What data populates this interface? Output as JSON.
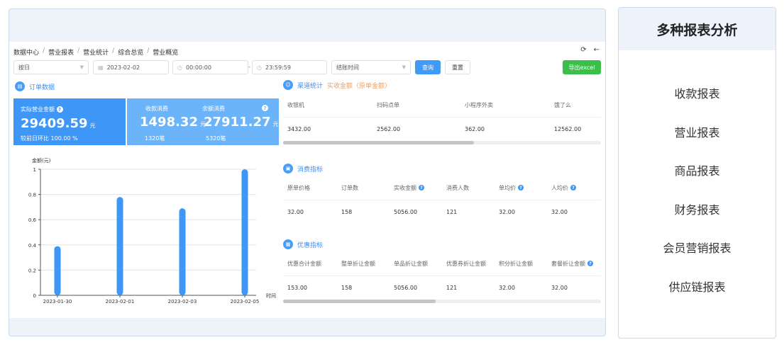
{
  "breadcrumb": [
    "数据中心",
    "营业报表",
    "营业统计",
    "综合总览",
    "营业概览"
  ],
  "breadcrumb_sep": "/",
  "filters": {
    "period": "按日",
    "date": "2023-02-02",
    "time_start": "00:00:00",
    "range_sep": "-",
    "time_end": "23:59:59",
    "time_type": "结账时间",
    "query": "查询",
    "reset": "重置",
    "export": "导出excel"
  },
  "order_section": {
    "title": "订单数据"
  },
  "card_actual": {
    "label": "实际营业金额",
    "value": "29409.59",
    "unit": "元",
    "compare": "较前日环比 100.00 %"
  },
  "card_other": {
    "label1": "收款消费",
    "value1": "1498.32",
    "unit1": "元",
    "count1": "1320笔",
    "label2": "余额消费",
    "value2": "27911.27",
    "unit2": "元",
    "count2": "5320笔"
  },
  "chart_data": {
    "type": "bar",
    "ylabel": "金额(元)",
    "xlabel": "时间",
    "x_ticks": [
      "2023-01-30",
      "2023-02-01",
      "2023-02-03",
      "2023-02-05"
    ],
    "categories": [
      "2023-01-30",
      "2023-01-31",
      "2023-02-01",
      "2023-02-02",
      "2023-02-03",
      "2023-02-04",
      "2023-02-05"
    ],
    "values": [
      0.39,
      0,
      0.78,
      0,
      0.69,
      0,
      1.0
    ],
    "ylim": [
      0,
      1
    ],
    "y_ticks": [
      "0",
      "0.2",
      "0.4",
      "0.6",
      "0.8",
      "1"
    ],
    "grid": true,
    "color": "#3e96f6"
  },
  "channel": {
    "title": "渠道统计",
    "subtitle": "实收金额（原单金额）",
    "headers": [
      "收银机",
      "扫码点单",
      "小程序外卖",
      "饿了么"
    ],
    "values": [
      "3432.00",
      "2562.00",
      "362.00",
      "12562.00"
    ],
    "scroll_fraction": 0.6
  },
  "consume": {
    "title": "消费指标",
    "headers": [
      "原单价格",
      "订单数",
      "实收金额",
      "消费人数",
      "单均价",
      "人均价"
    ],
    "help": [
      false,
      false,
      true,
      false,
      true,
      true
    ],
    "values": [
      "32.00",
      "158",
      "5056.00",
      "121",
      "32.00",
      "32.00"
    ]
  },
  "discount": {
    "title": "优惠指标",
    "headers": [
      "优惠合计金额",
      "整单折让金额",
      "单品折让金额",
      "优惠券折让金额",
      "积分折让金额",
      "套餐折让金额"
    ],
    "help": [
      false,
      false,
      false,
      false,
      false,
      true
    ],
    "values": [
      "153.00",
      "158",
      "5056.00",
      "121",
      "32.00",
      "32.00"
    ],
    "scroll_fraction": 0.48
  },
  "help_mark": "?",
  "side_panel": {
    "title": "多种报表分析",
    "items": [
      "收款报表",
      "营业报表",
      "商品报表",
      "财务报表",
      "会员营销报表",
      "供应链报表"
    ]
  }
}
